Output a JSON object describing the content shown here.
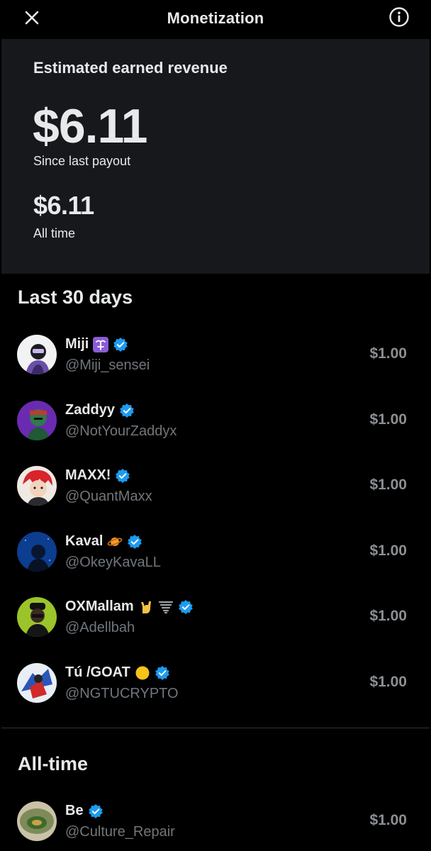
{
  "header": {
    "title": "Monetization",
    "close_icon": "close-icon",
    "info_icon": "info-icon"
  },
  "summary": {
    "heading": "Estimated earned revenue",
    "since_last_payout_value": "$6.11",
    "since_last_payout_label": "Since last payout",
    "all_time_value": "$6.11",
    "all_time_label": "All time"
  },
  "last30": {
    "title": "Last 30 days",
    "rows": [
      {
        "name": "Miji",
        "handle": "@Miji_sensei",
        "amount": "$1.00",
        "emoji": "ophiuchus-emoji"
      },
      {
        "name": "Zaddyy",
        "handle": "@NotYourZaddyx",
        "amount": "$1.00"
      },
      {
        "name": "MAXX!",
        "handle": "@QuantMaxx",
        "amount": "$1.00"
      },
      {
        "name": "Kaval",
        "handle": "@OkeyKavaLL",
        "amount": "$1.00",
        "emoji": "ringed-planet-emoji"
      },
      {
        "name": "OXMallam",
        "handle": "@Adellbah",
        "amount": "$1.00",
        "emoji": "rock-hand-tornado-emoji"
      },
      {
        "name": "Tú /GOAT",
        "handle": "@NGTUCRYPTO",
        "amount": "$1.00",
        "emoji": "yellow-circle-emoji"
      }
    ]
  },
  "alltime": {
    "title": "All-time",
    "rows": [
      {
        "name": "Be",
        "handle": "@Culture_Repair",
        "amount": "$1.00"
      }
    ]
  },
  "colors": {
    "background": "#000000",
    "card": "#16181c",
    "primary_text": "#e7e9ea",
    "secondary_text": "#71767b",
    "amount_text": "#8b8f93",
    "verified_blue": "#1d9bf0"
  }
}
